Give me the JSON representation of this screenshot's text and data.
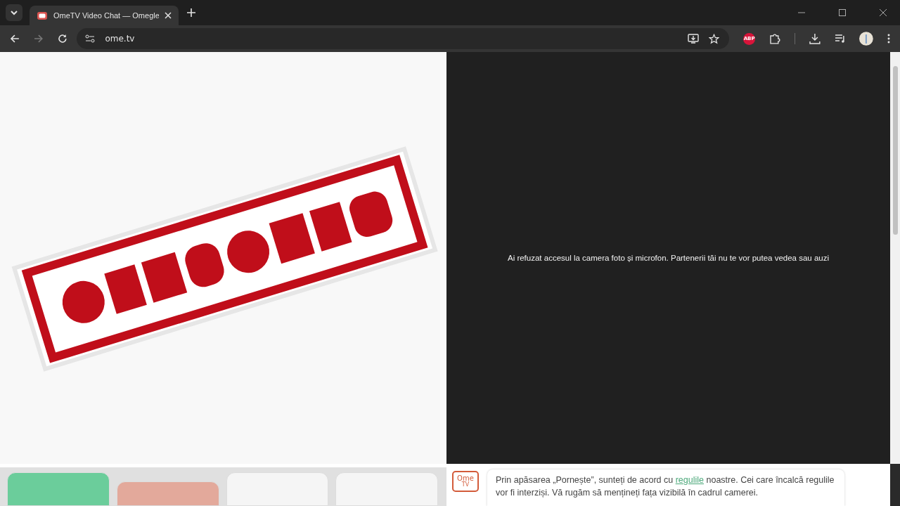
{
  "browser": {
    "tabs": [
      {
        "title": "OmeTV Video Chat — Omegle",
        "selected": true
      }
    ],
    "address": "ome.tv",
    "adblock_badge": "ABP"
  },
  "partner_panel": {
    "message": "Ai refuzat accesul la camera foto și microfon. Partenerii tăi nu te vor putea vedea sau auzi"
  },
  "controls": [
    {
      "color": "#6bcd9b",
      "raised": true
    },
    {
      "color": "#e3a99b",
      "raised": false
    },
    {
      "color": "#f5f5f5",
      "raised": true
    },
    {
      "color": "#f5f5f5",
      "raised": true
    }
  ],
  "notice": {
    "logo": "Ome",
    "logo_sub": "TV",
    "before": "Prin apăsarea „Pornește”, sunteți de acord cu ",
    "link": "regulile",
    "after": " noastre. Cei care încalcă regulile vor fi interziși. Vă rugăm să mențineți fața vizibilă în cadrul camerei."
  }
}
